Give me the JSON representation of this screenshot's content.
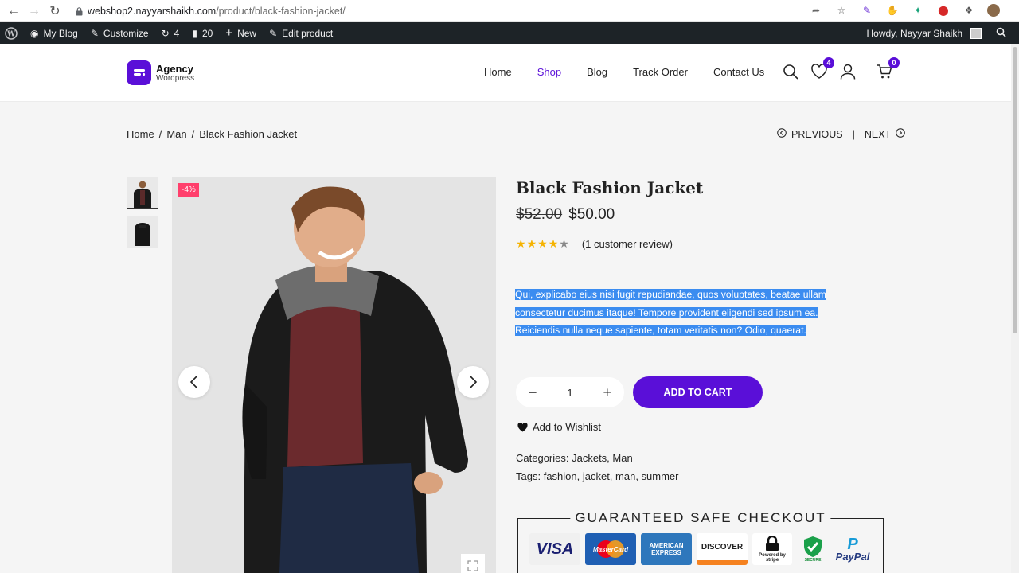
{
  "browser": {
    "url_domain": "webshop2.nayyarshaikh.com",
    "url_path": "/product/black-fashion-jacket/"
  },
  "admin_bar": {
    "my_blog": "My Blog",
    "customize": "Customize",
    "updates_count": "4",
    "comments_count": "20",
    "new": "New",
    "edit_product": "Edit product",
    "howdy": "Howdy, Nayyar Shaikh"
  },
  "header": {
    "logo_main": "Agency",
    "logo_sub": "Wordpress",
    "nav": [
      "Home",
      "Shop",
      "Blog",
      "Track Order",
      "Contact Us"
    ],
    "wishlist_count": "4",
    "cart_count": "0"
  },
  "breadcrumb": [
    "Home",
    "Man",
    "Black Fashion Jacket"
  ],
  "pagination": {
    "previous": "PREVIOUS",
    "separator": "|",
    "next": "NEXT"
  },
  "gallery": {
    "sale_badge": "-4%"
  },
  "product": {
    "title": "Black Fashion Jacket",
    "old_price": "$52.00",
    "price": "$50.00",
    "rating_value": 4,
    "rating_max": 5,
    "review_text": "(1 customer review)",
    "description_lines": [
      "Qui, explicabo eius nisi fugit repudiandae, quos voluptates, beatae ullam",
      "consectetur ducimus itaque! Tempore provident eligendi sed ipsum ea.",
      "Reiciendis nulla neque sapiente, totam veritatis non? Odio, quaerat."
    ],
    "quantity": "1",
    "add_to_cart": "ADD TO CART",
    "wishlist": "Add to Wishlist",
    "categories_label": "Categories:",
    "categories": "Jackets, Man",
    "tags_label": "Tags:",
    "tags": "fashion, jacket, man, summer"
  },
  "checkout": {
    "title": "GUARANTEED SAFE CHECKOUT",
    "logos": [
      "VISA",
      "MasterCard",
      "AMERICAN EXPRESS",
      "DISCOVER",
      "Powered by stripe",
      "SECURE",
      "PayPal"
    ]
  },
  "colors": {
    "accent": "#5a0fd8",
    "sale": "#ff3f6c",
    "selection": "#3b8cf0",
    "admin_bar": "#1d2327"
  }
}
